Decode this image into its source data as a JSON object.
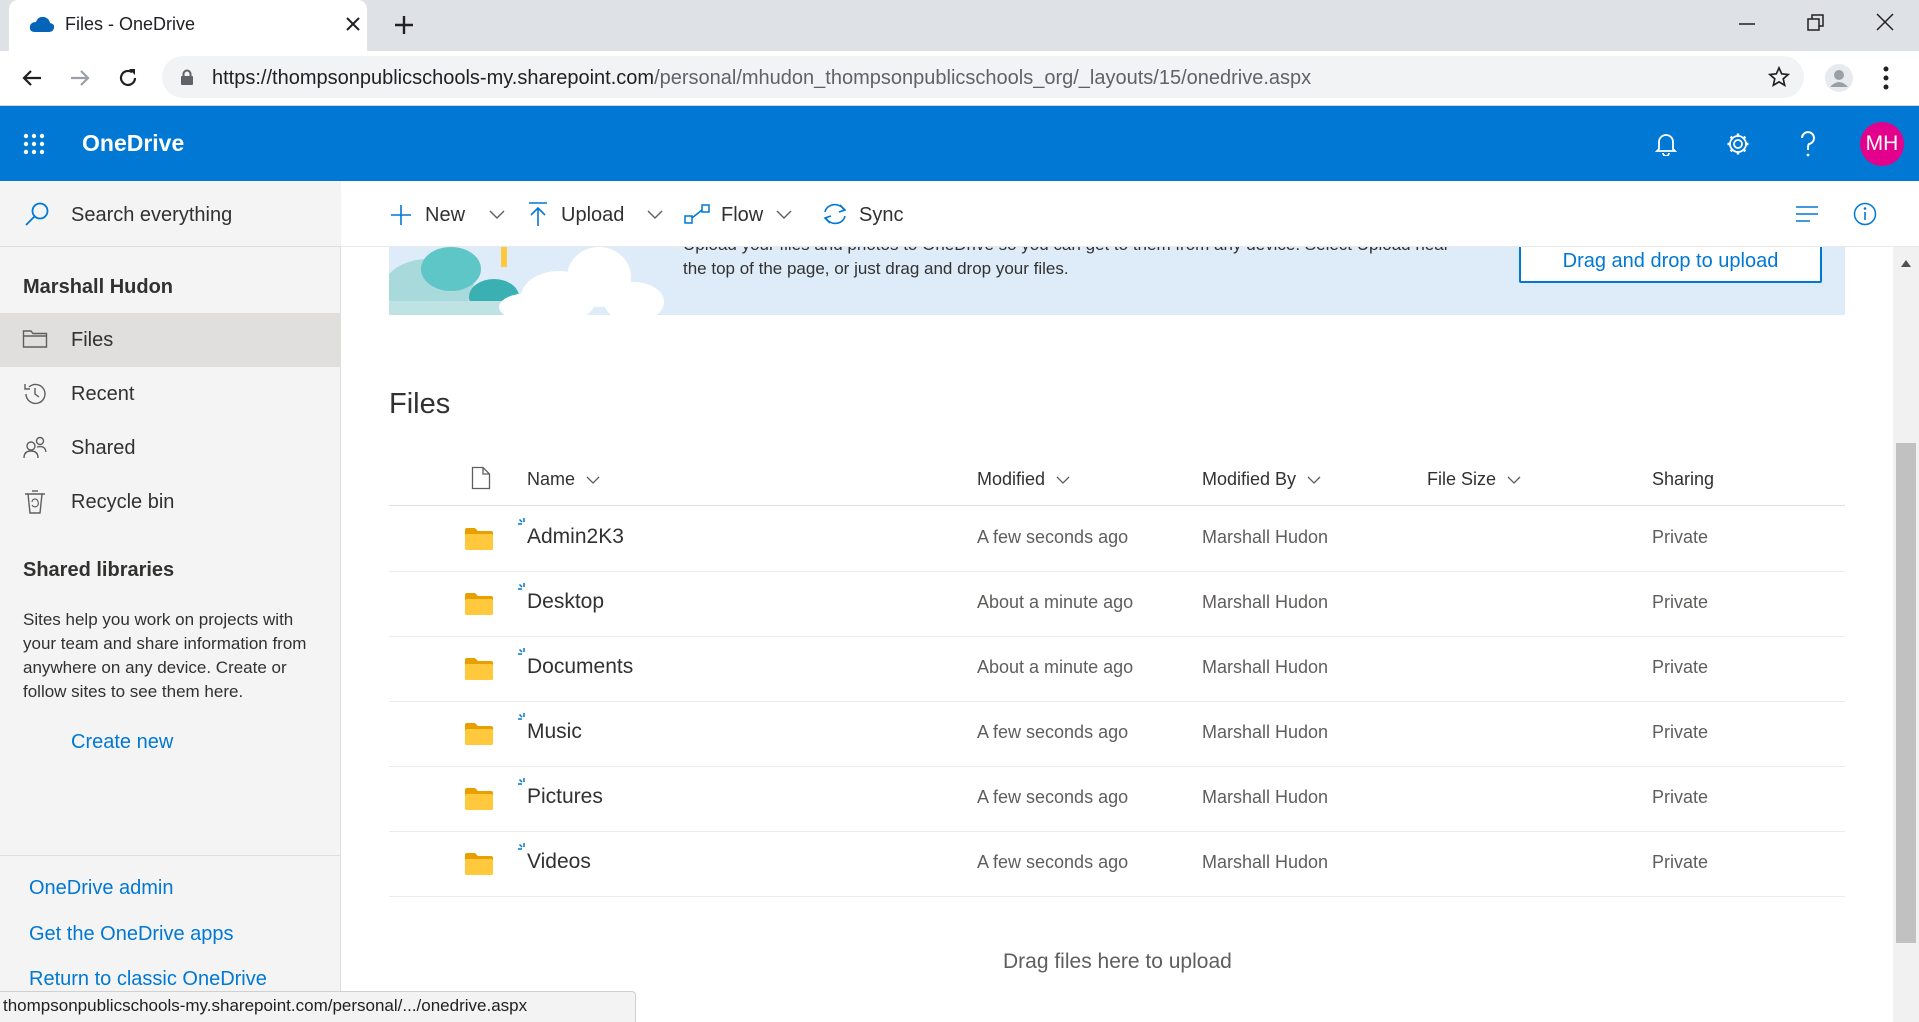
{
  "browser": {
    "tab_title": "Files - OneDrive",
    "url_host": "https://thompsonpublicschools-my.sharepoint.com",
    "url_path": "/personal/mhudon_thompsonpublicschools_org/_layouts/15/onedrive.aspx",
    "status_url": "thompsonpublicschools-my.sharepoint.com/personal/.../onedrive.aspx"
  },
  "header": {
    "app_name": "OneDrive",
    "avatar_initials": "MH",
    "accent_color": "#0078d4",
    "avatar_color": "#e3008c"
  },
  "nav": {
    "search_label": "Search everything",
    "user_name": "Marshall Hudon",
    "items": [
      {
        "label": "Files",
        "icon": "folder-icon",
        "selected": true
      },
      {
        "label": "Recent",
        "icon": "clock-icon"
      },
      {
        "label": "Shared",
        "icon": "people-icon"
      },
      {
        "label": "Recycle bin",
        "icon": "recycle-bin-icon"
      }
    ],
    "shared_libraries_title": "Shared libraries",
    "shared_libraries_desc": "Sites help you work on projects with your team and share information from anywhere on any device. Create or follow sites to see them here.",
    "create_new": "Create new",
    "bottom_links": [
      "OneDrive admin",
      "Get the OneDrive apps",
      "Return to classic OneDrive"
    ]
  },
  "commands": {
    "new": "New",
    "upload": "Upload",
    "flow": "Flow",
    "sync": "Sync"
  },
  "banner": {
    "text": "Upload your files and photos to OneDrive so you can get to them from any device. Select Upload near the top of the page, or just drag and drop your files.",
    "button": "Drag and drop to upload"
  },
  "files": {
    "title": "Files",
    "columns": {
      "name": "Name",
      "modified": "Modified",
      "modified_by": "Modified By",
      "file_size": "File Size",
      "sharing": "Sharing"
    },
    "rows": [
      {
        "name": "Admin2K3",
        "modified": "A few seconds ago",
        "modified_by": "Marshall Hudon",
        "size": "",
        "sharing": "Private"
      },
      {
        "name": "Desktop",
        "modified": "About a minute ago",
        "modified_by": "Marshall Hudon",
        "size": "",
        "sharing": "Private"
      },
      {
        "name": "Documents",
        "modified": "About a minute ago",
        "modified_by": "Marshall Hudon",
        "size": "",
        "sharing": "Private"
      },
      {
        "name": "Music",
        "modified": "A few seconds ago",
        "modified_by": "Marshall Hudon",
        "size": "",
        "sharing": "Private"
      },
      {
        "name": "Pictures",
        "modified": "A few seconds ago",
        "modified_by": "Marshall Hudon",
        "size": "",
        "sharing": "Private"
      },
      {
        "name": "Videos",
        "modified": "A few seconds ago",
        "modified_by": "Marshall Hudon",
        "size": "",
        "sharing": "Private"
      }
    ],
    "dropzone": "Drag files here to upload"
  }
}
